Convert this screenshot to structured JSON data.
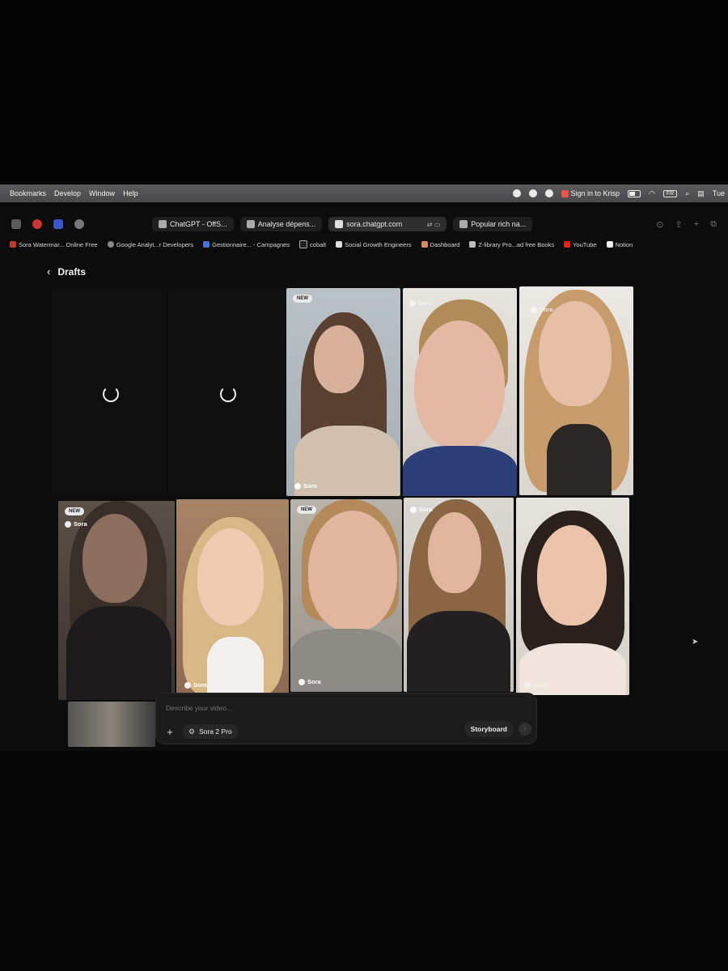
{
  "menubar": {
    "items": [
      "Bookmarks",
      "Develop",
      "Window",
      "Help"
    ],
    "krisp": "Sign in to Krisp",
    "input_source": "FR",
    "clock": "Tue"
  },
  "tabs": [
    {
      "label": "ChatGPT - OffS...",
      "icon": "chatgpt-icon"
    },
    {
      "label": "Analyse dépens...",
      "icon": "chatgpt-icon"
    },
    {
      "label": "sora.chatgpt.com",
      "icon": "sora-icon",
      "active": true
    },
    {
      "label": "Popular rich na...",
      "icon": "chatgpt-icon"
    }
  ],
  "bookmarks": [
    {
      "label": "Sora Watermar... Online Free",
      "color": "#c0392b"
    },
    {
      "label": "Google Analyt...r Developers",
      "color": "#888888"
    },
    {
      "label": "Gestionnaire... - Campagnes",
      "color": "#4a6fd8"
    },
    {
      "label": "cobalt",
      "color": "#222222"
    },
    {
      "label": "Social Growth Engineers",
      "color": "#dddddd"
    },
    {
      "label": "Dashboard",
      "color": "#d48a6a"
    },
    {
      "label": "Z-library Pro...ad free Books",
      "color": "#bbbbbb"
    },
    {
      "label": "YouTube",
      "color": "#e62117"
    },
    {
      "label": "Notion",
      "color": "#eeeeee"
    }
  ],
  "page": {
    "title": "Drafts"
  },
  "tiles": {
    "badge_new": "NEW",
    "sora_label": "Sora"
  },
  "composer": {
    "placeholder": "Describe your video...",
    "model": "Sora 2 Pro",
    "storyboard": "Storyboard"
  }
}
